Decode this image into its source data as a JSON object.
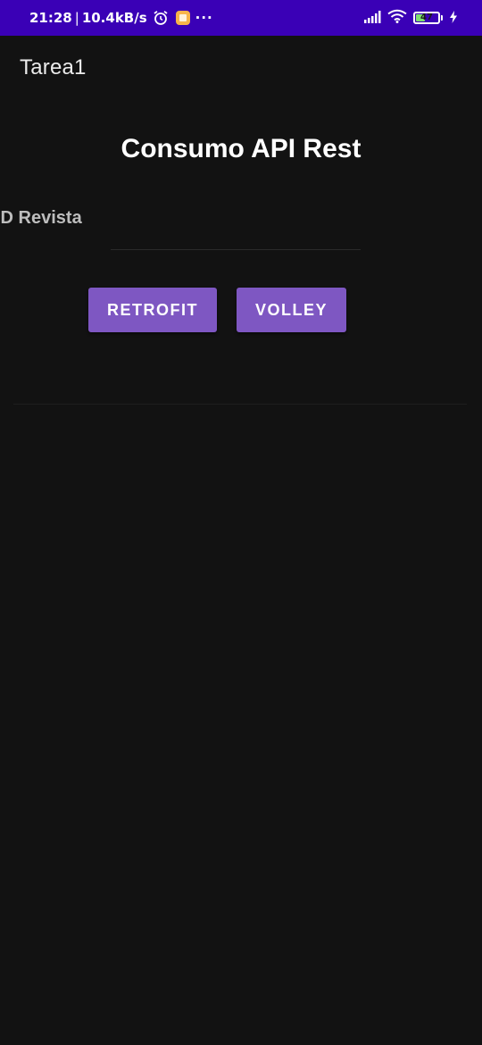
{
  "status_bar": {
    "time": "21:28",
    "separator": "|",
    "network_speed": "10.4kB/s",
    "more_dots": "···",
    "battery_level": "47",
    "battery_fraction": 0.47,
    "icons": [
      "alarm-icon",
      "app-notification-icon",
      "signal-icon",
      "wifi-icon",
      "battery-icon",
      "charging-icon"
    ]
  },
  "app_bar": {
    "title": "Tarea1"
  },
  "main": {
    "heading": "Consumo API Rest",
    "id_label": "ID Revista",
    "id_input_value": "",
    "buttons": {
      "retrofit": "RETROFIT",
      "volley": "VOLLEY"
    }
  },
  "colors": {
    "status_bar_bg": "#3a00b6",
    "background": "#121212",
    "button_bg": "#7e57c2"
  }
}
